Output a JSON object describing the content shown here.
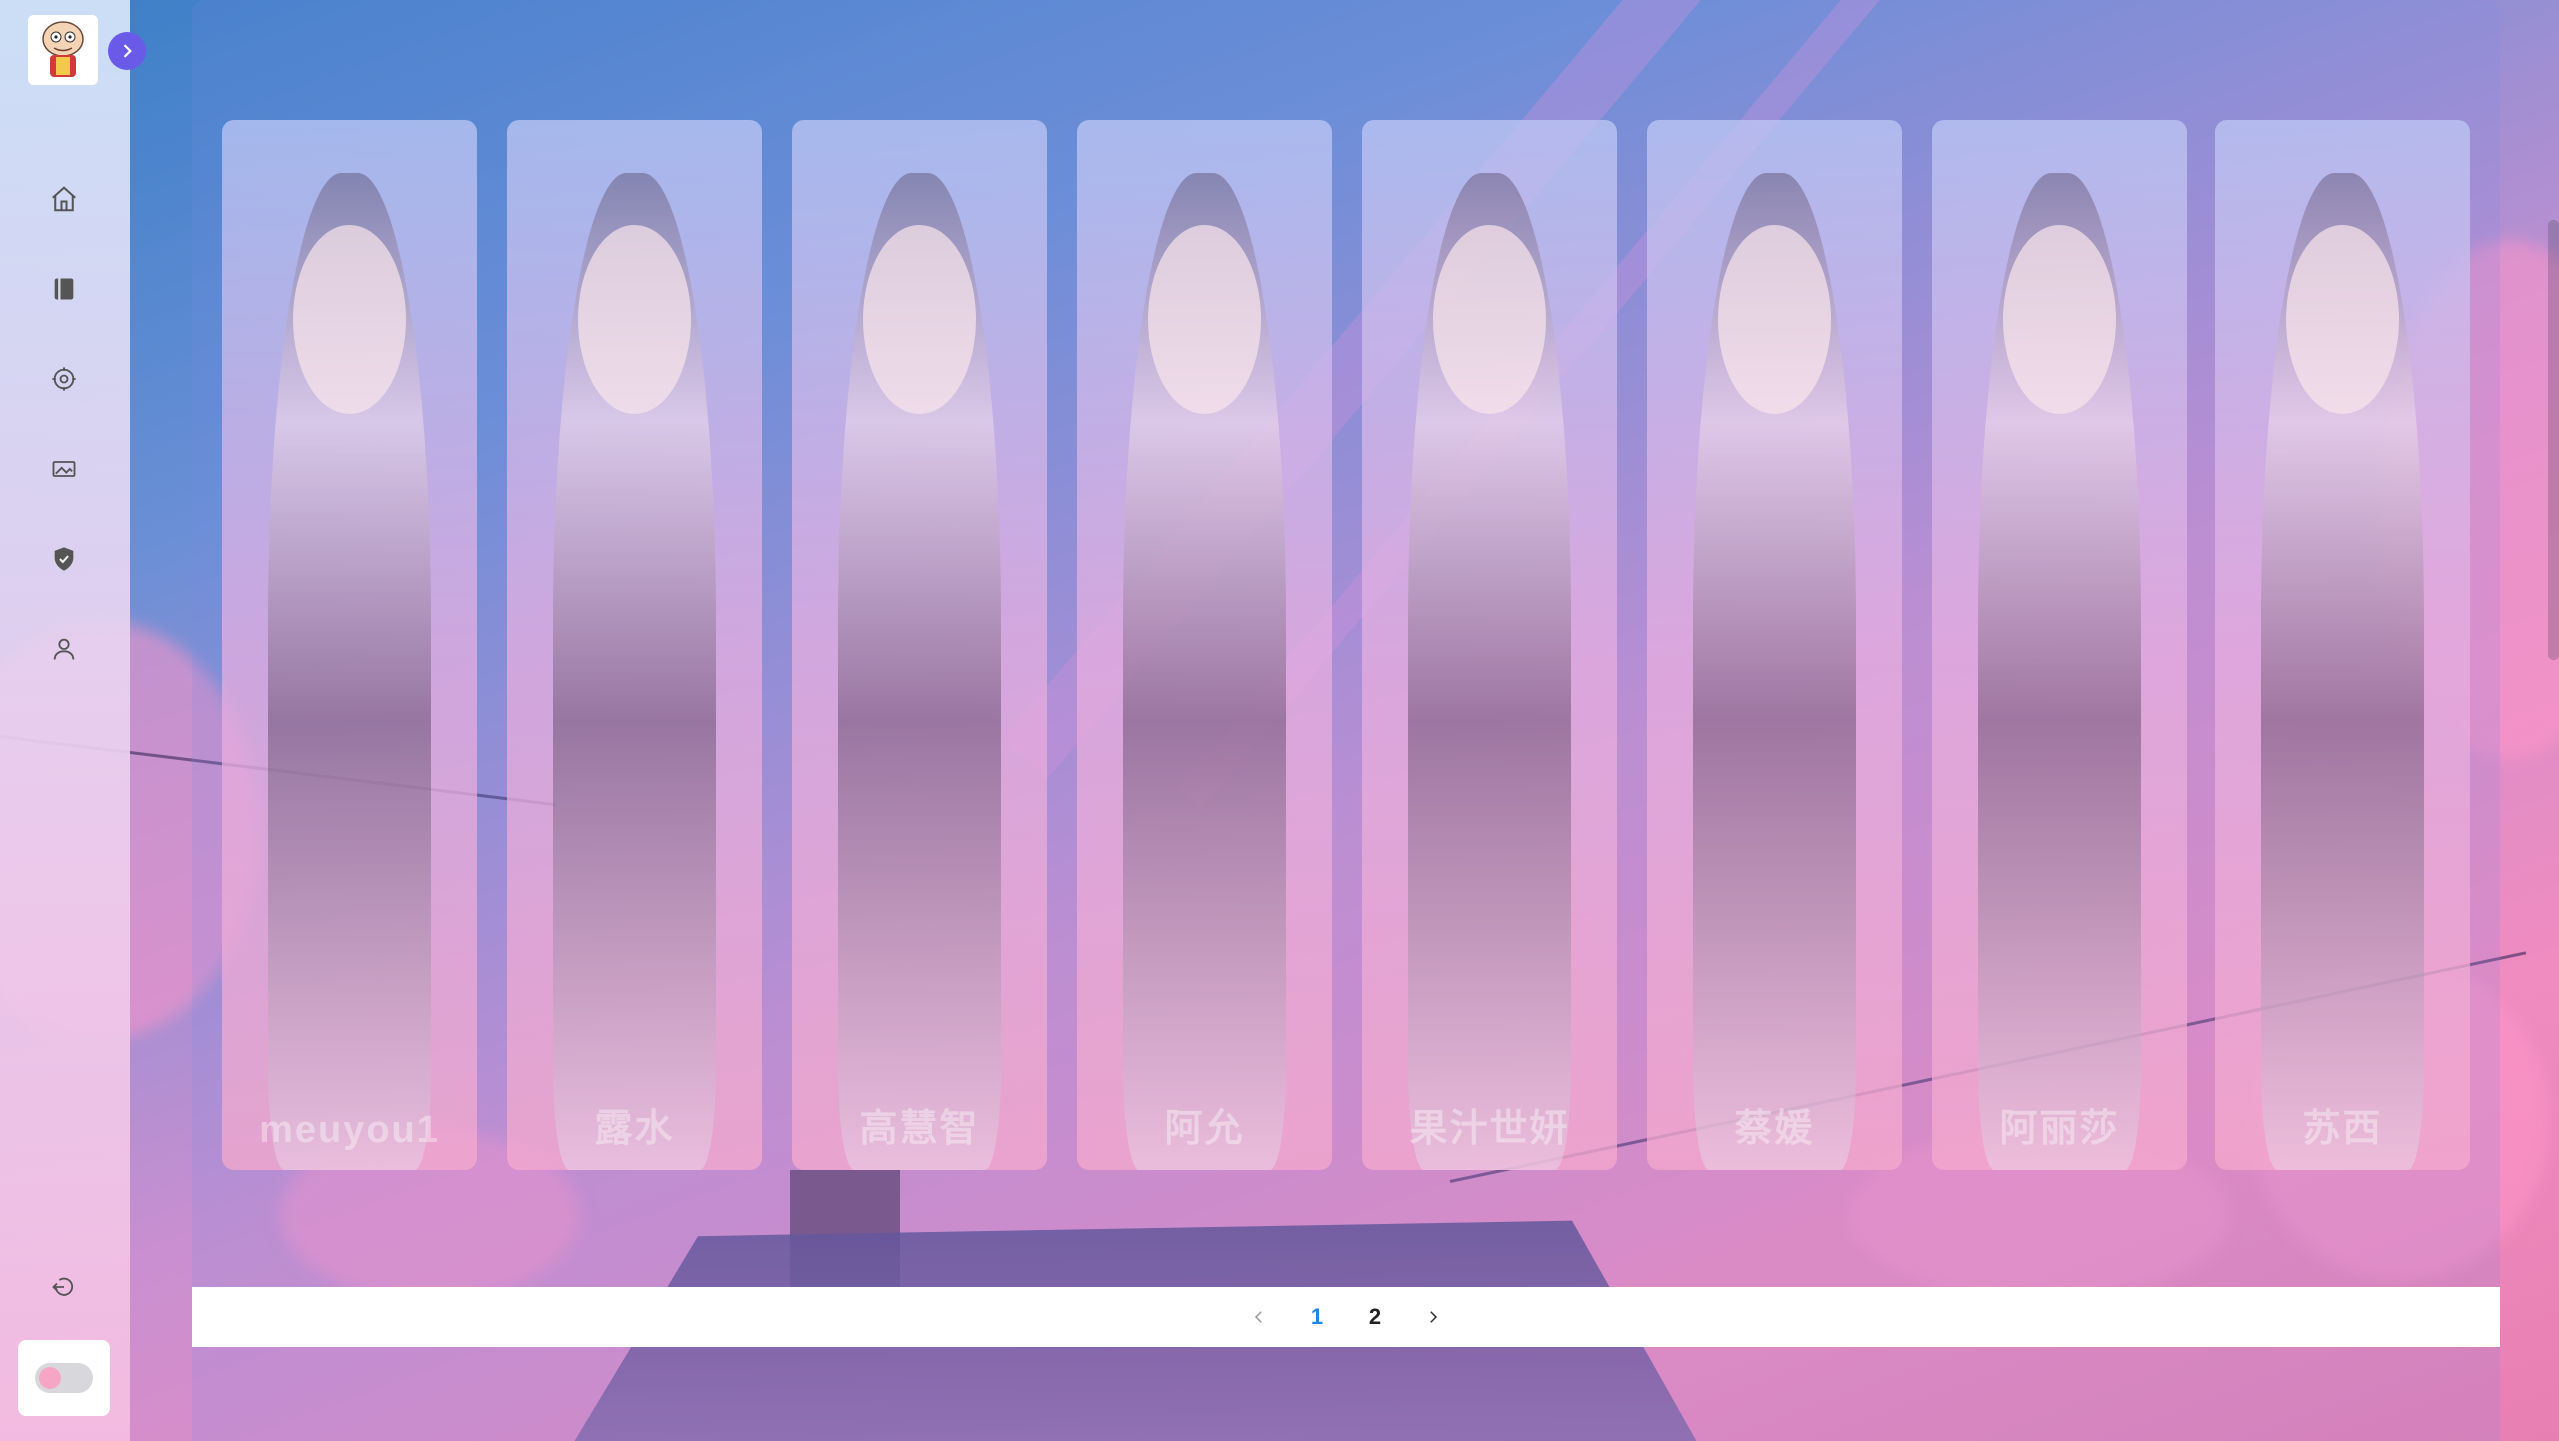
{
  "sidebar": {
    "logo_alt": "site logo",
    "expand_icon": "chevron-right-icon",
    "nav": [
      {
        "id": "home",
        "icon": "home-icon"
      },
      {
        "id": "book",
        "icon": "book-icon"
      },
      {
        "id": "discover",
        "icon": "compass-icon"
      },
      {
        "id": "gallery",
        "icon": "image-icon"
      },
      {
        "id": "vip",
        "icon": "shield-icon"
      },
      {
        "id": "profile",
        "icon": "user-icon"
      }
    ],
    "logout_icon": "logout-icon",
    "theme_toggle": {
      "state": "off",
      "knob_color": "#f4a6c4"
    }
  },
  "cards": [
    {
      "name": "meuyou1"
    },
    {
      "name": "露水"
    },
    {
      "name": "高慧智"
    },
    {
      "name": "阿允"
    },
    {
      "name": "果汁世妍"
    },
    {
      "name": "蔡媛"
    },
    {
      "name": "阿丽莎"
    },
    {
      "name": "苏西"
    }
  ],
  "pagination": {
    "prev_icon": "chevron-left-icon",
    "pages": [
      "1",
      "2"
    ],
    "current": "1",
    "next_icon": "chevron-right-icon"
  },
  "colors": {
    "accent": "#6a5ae8",
    "page_active": "#1e88e5"
  }
}
